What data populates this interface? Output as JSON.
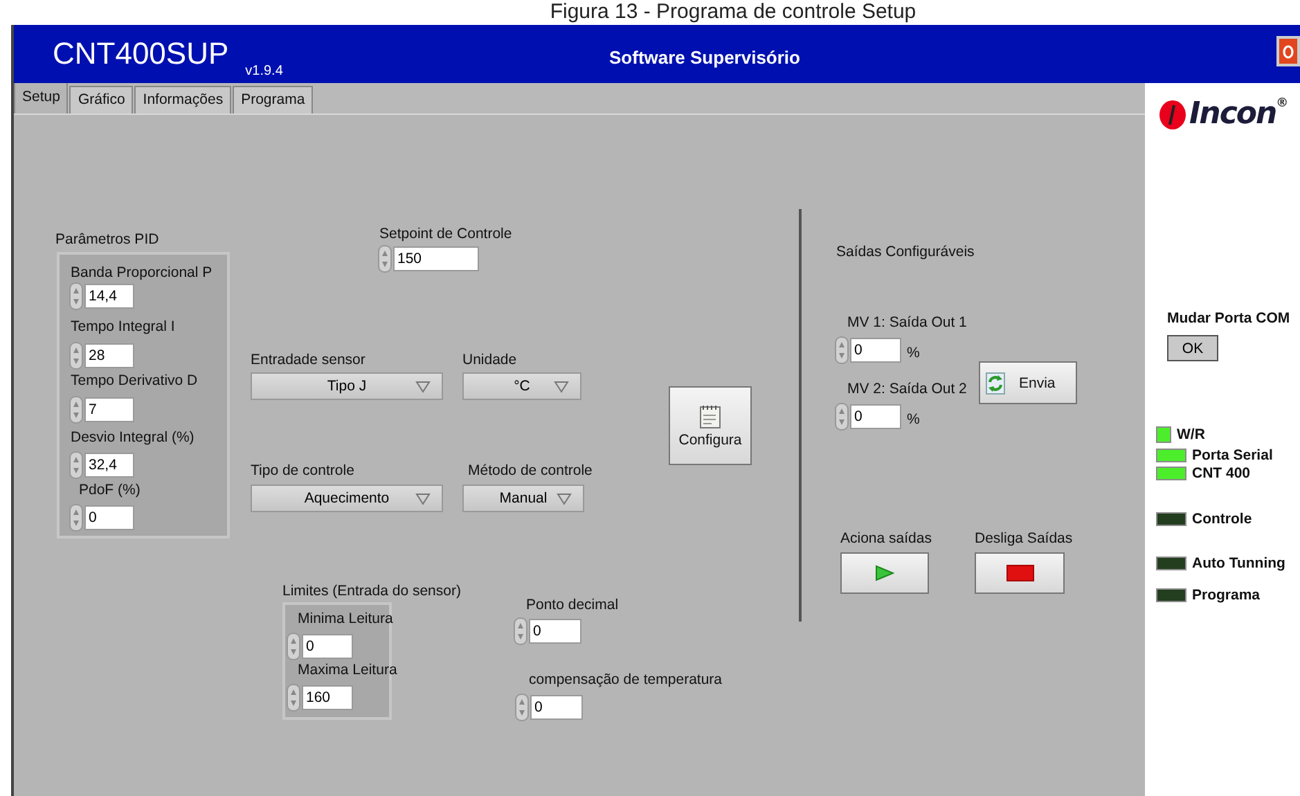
{
  "caption": "Figura 13 - Programa de controle Setup",
  "window": {
    "title": "CNT400SUP",
    "version": "v1.9.4",
    "subtitle": "Software Supervisório"
  },
  "tabs": [
    {
      "label": "Setup",
      "selected": true
    },
    {
      "label": "Gráfico",
      "selected": false
    },
    {
      "label": "Informações",
      "selected": false
    },
    {
      "label": "Programa",
      "selected": false
    }
  ],
  "pid_group": {
    "label": "Parâmetros PID",
    "fields": [
      {
        "label": "Banda Proporcional P",
        "value": "14,4"
      },
      {
        "label": "Tempo  Integral I",
        "value": "28"
      },
      {
        "label": "Tempo  Derivativo D",
        "value": "7"
      },
      {
        "label": "Desvio Integral (%)",
        "value": "32,4"
      },
      {
        "label": "PdoF (%)",
        "value": "0"
      }
    ]
  },
  "setpoint": {
    "label": "Setpoint de Controle",
    "value": "150"
  },
  "dropdowns": [
    {
      "label": "Entradade sensor",
      "value": "Tipo J"
    },
    {
      "label": "Unidade",
      "value": "°C"
    },
    {
      "label": "Tipo de controle",
      "value": "Aquecimento"
    },
    {
      "label": "Método de controle",
      "value": "Manual"
    }
  ],
  "configure_button": "Configura",
  "outputs": {
    "title": "Saídas  Configuráveis",
    "fields": [
      {
        "label": "MV 1: Saída Out 1",
        "value": "0",
        "unit": "%"
      },
      {
        "label": "MV 2: Saída Out 2",
        "value": "0",
        "unit": "%"
      }
    ],
    "send_button": "Envia",
    "enable_label": "Aciona saídas",
    "disable_label": "Desliga Saídas"
  },
  "limits": {
    "label": "Limites (Entrada do sensor)",
    "fields": [
      {
        "label": "Minima Leitura",
        "value": "0"
      },
      {
        "label": "Maxima Leitura",
        "value": "160"
      }
    ]
  },
  "decimal_point": {
    "label": "Ponto decimal",
    "value": "0"
  },
  "temp_compensation": {
    "label": "compensação de temperatura",
    "value": "0"
  },
  "side": {
    "logo": "Incon",
    "registered": "®",
    "port_label": "Mudar Porta COM",
    "ok_button": "OK",
    "indicators": [
      {
        "label": "W/R",
        "on": true,
        "kind": "square"
      },
      {
        "label": "Porta Serial",
        "on": true,
        "kind": "bar"
      },
      {
        "label": "CNT 400",
        "on": true,
        "kind": "bar"
      },
      {
        "label": "Controle",
        "on": false,
        "kind": "bar"
      },
      {
        "label": "Auto Tunning",
        "on": false,
        "kind": "bar"
      },
      {
        "label": "Programa",
        "on": false,
        "kind": "bar"
      }
    ]
  }
}
